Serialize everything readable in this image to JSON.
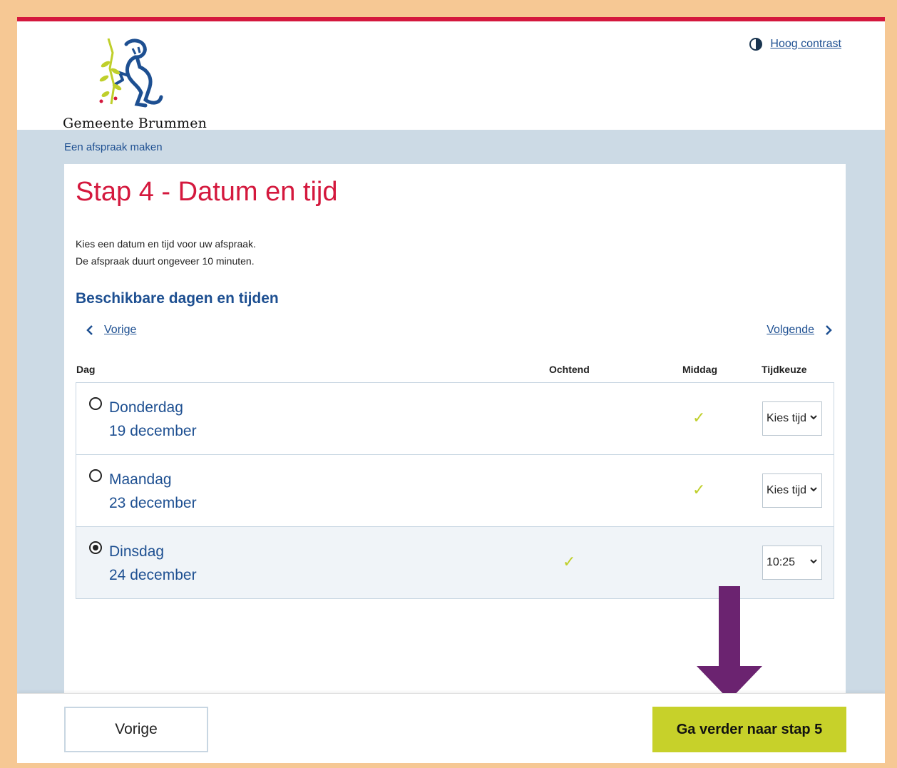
{
  "header": {
    "org_name": "Gemeente Brummen",
    "contrast_link": "Hoog contrast"
  },
  "breadcrumb": "Een afspraak maken",
  "page": {
    "title": "Stap 4 - Datum en tijd",
    "intro_line1": "Kies een datum en tijd voor uw afspraak.",
    "intro_line2": "De afspraak duurt ongeveer 10 minuten.",
    "subtitle": "Beschikbare dagen en tijden"
  },
  "nav": {
    "prev_label": "Vorige",
    "next_label": "Volgende"
  },
  "table": {
    "columns": [
      "Dag",
      "Ochtend",
      "Middag",
      "Tijdkeuze"
    ],
    "rows": [
      {
        "weekday": "Donderdag",
        "date": "19 december",
        "morning": false,
        "afternoon": true,
        "time": "Kies tijd",
        "selected": false
      },
      {
        "weekday": "Maandag",
        "date": "23 december",
        "morning": false,
        "afternoon": true,
        "time": "Kies tijd",
        "selected": false
      },
      {
        "weekday": "Dinsdag",
        "date": "24 december",
        "morning": true,
        "afternoon": false,
        "time": "10:25",
        "selected": true
      }
    ]
  },
  "footer": {
    "prev_button": "Vorige",
    "next_button": "Ga verder naar stap 5"
  },
  "colors": {
    "accent_red": "#d4183d",
    "link_blue": "#1d4f91",
    "check_green": "#bfcf2a",
    "cta_green": "#c7d12a",
    "annotation_arrow": "#6b2370"
  }
}
